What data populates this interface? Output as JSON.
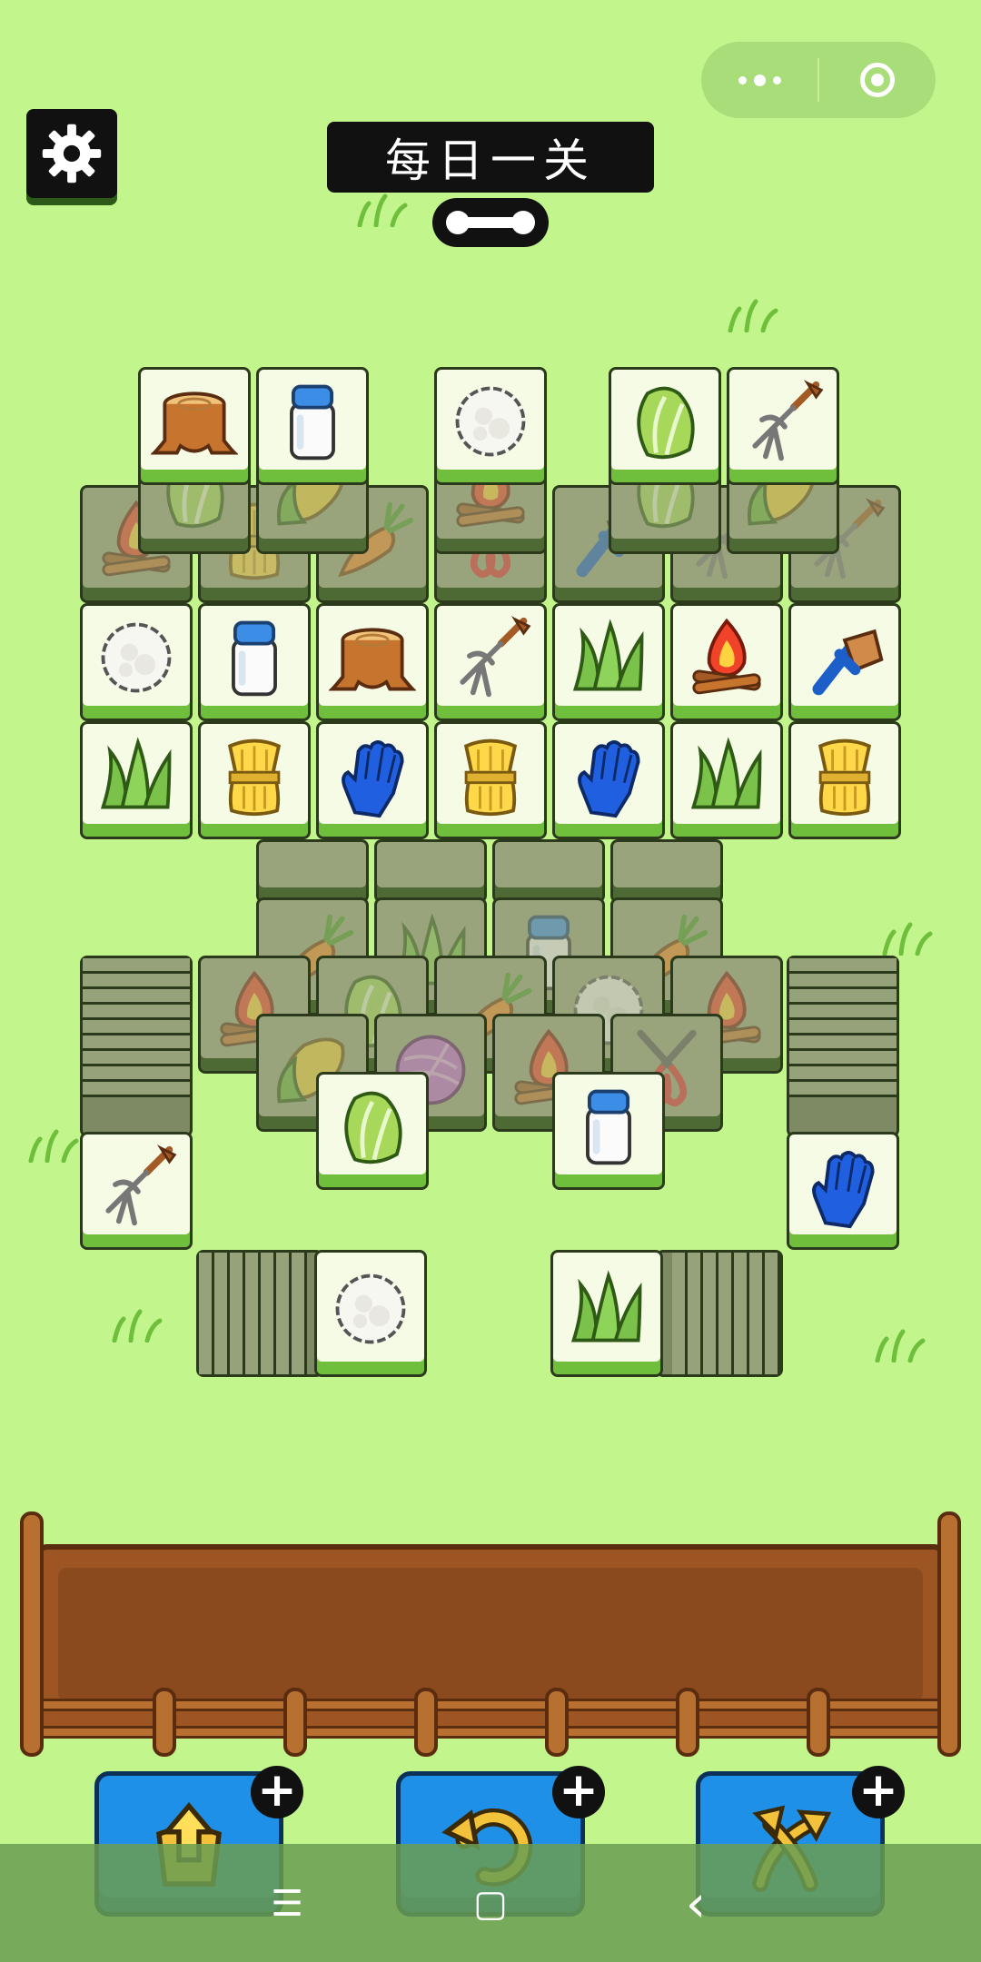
{
  "header": {
    "title": "每日一关",
    "settings_icon": "gear-icon",
    "progress_icon": "bone-icon"
  },
  "capsule": {
    "menu_icon": "more-dots-icon",
    "close_icon": "target-circle-icon"
  },
  "board": {
    "top_row": [
      "stump",
      "milk",
      "cotton",
      "cabbage",
      "pitchfork"
    ],
    "row_2": [
      "cotton",
      "milk",
      "stump",
      "pitchfork",
      "grass",
      "campfire",
      "brush"
    ],
    "row_3": [
      "grass",
      "wheat",
      "glove",
      "wheat",
      "glove",
      "grass",
      "wheat"
    ],
    "lower_left_tiles": [
      "pitchfork",
      "cabbage",
      "cotton"
    ],
    "lower_right_tiles": [
      "milk",
      "glove",
      "grass"
    ]
  },
  "tools": [
    {
      "name": "move-out",
      "icon": "move-out-icon",
      "plus": "+"
    },
    {
      "name": "undo",
      "icon": "undo-icon",
      "plus": "+"
    },
    {
      "name": "shuffle",
      "icon": "shuffle-icon",
      "plus": "+"
    }
  ],
  "navbar": {
    "menu": "☰",
    "home": "▢",
    "back": "‹"
  },
  "colors": {
    "background": "#c2f58c",
    "tile_face": "#f6fbe6",
    "tile_base": "#6fbf3c",
    "tray": "#9c5523",
    "tool_button": "#1e90e8"
  }
}
